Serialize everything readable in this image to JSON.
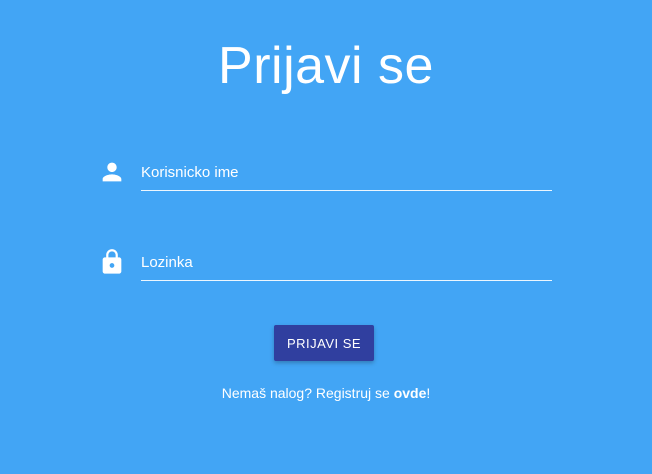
{
  "page": {
    "background_color": "#42a5f5",
    "title": "Prijavi se"
  },
  "form": {
    "username": {
      "icon": "person-icon",
      "placeholder": "Korisnicko ime",
      "value": ""
    },
    "password": {
      "icon": "lock-icon",
      "placeholder": "Lozinka",
      "value": ""
    },
    "submit_label": "PRIJAVI SE",
    "submit_color": "#303f9f"
  },
  "footer": {
    "prefix": "Nemaš nalog? Registruj se ",
    "link_label": "ovde",
    "suffix": "!"
  }
}
